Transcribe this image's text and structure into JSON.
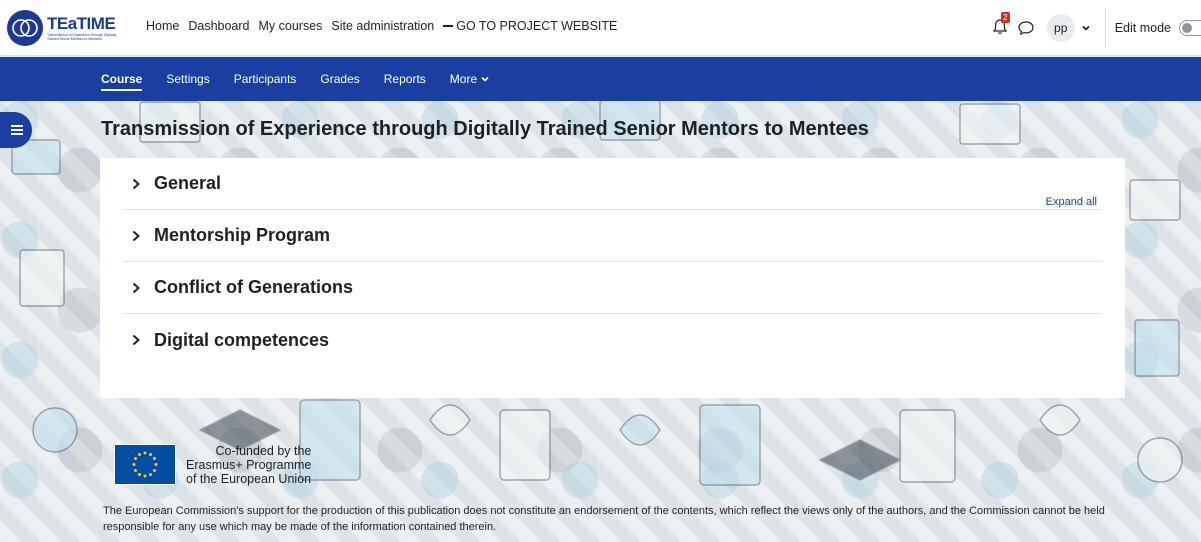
{
  "header": {
    "logo_title": "TEaTIME",
    "logo_subtitle": "Transmission of Experience through Digitally Trained Senior Mentors to Mentees",
    "nav": [
      "Home",
      "Dashboard",
      "My courses",
      "Site administration"
    ],
    "project_link": "GO TO PROJECT WEBSITE",
    "notification_count": "2",
    "user_initials": "pp",
    "edit_mode_label": "Edit mode"
  },
  "secondary_nav": {
    "items": [
      "Course",
      "Settings",
      "Participants",
      "Grades",
      "Reports",
      "More"
    ],
    "active": "Course"
  },
  "course": {
    "title": "Transmission of Experience through Digitally Trained Senior Mentors to Mentees",
    "expand_all_label": "Expand all",
    "sections": [
      "General",
      "Mentorship Program",
      "Conflict of Generations",
      "Digital competences"
    ]
  },
  "footer": {
    "eu_line1": "Co-funded by the",
    "eu_line2": "Erasmus+ Programme",
    "eu_line3": "of the European Union",
    "disclaimer": "The European Commission's support for the production of this publication does not constitute an endorsement of the contents, which reflect the views only of the authors, and the Commission cannot be held responsible for any use which may be made of the information contained therein."
  },
  "colors": {
    "primary": "#1b3fa1",
    "badge": "#ca3120",
    "eu_blue": "#034ea2",
    "eu_star": "#ffcc00"
  }
}
